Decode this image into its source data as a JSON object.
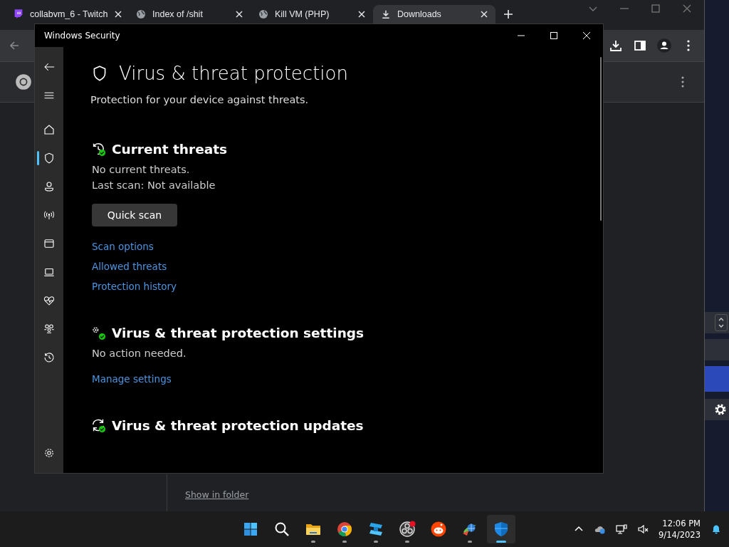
{
  "browser": {
    "tabs": [
      {
        "kind": "twitch",
        "label": "collabvm_6 - Twitch",
        "selected": false
      },
      {
        "kind": "globe",
        "label": "Index of /shit",
        "selected": false
      },
      {
        "kind": "globe",
        "label": "Kill VM (PHP)",
        "selected": false
      },
      {
        "kind": "download",
        "label": "Downloads",
        "selected": true
      }
    ],
    "download_link": "Show in folder"
  },
  "security": {
    "title": "Windows Security",
    "nav": [
      {
        "kind": "home",
        "selected": false
      },
      {
        "kind": "shield",
        "selected": true
      },
      {
        "kind": "person",
        "selected": false
      },
      {
        "kind": "antenna",
        "selected": false
      },
      {
        "kind": "window",
        "selected": false
      },
      {
        "kind": "laptop",
        "selected": false
      },
      {
        "kind": "heart",
        "selected": false
      },
      {
        "kind": "family",
        "selected": false
      },
      {
        "kind": "history",
        "selected": false
      }
    ],
    "page_title": "Virus & threat protection",
    "subtitle": "Protection for your device against threats.",
    "sections": [
      {
        "kind": "threats",
        "title": "Current threats",
        "lines": [
          "No current threats.",
          "Last scan: Not available"
        ],
        "button": "Quick scan",
        "links": [
          "Scan options",
          "Allowed threats",
          "Protection history"
        ]
      },
      {
        "kind": "settings",
        "title": "Virus & threat protection settings",
        "lines": [
          "No action needed."
        ],
        "links": [
          "Manage settings"
        ]
      },
      {
        "kind": "updates",
        "title": "Virus & threat protection updates"
      }
    ]
  },
  "taskbar": {
    "apps": [
      {
        "kind": "start",
        "running": false,
        "active": false
      },
      {
        "kind": "search",
        "running": false,
        "active": false
      },
      {
        "kind": "explorer",
        "running": true,
        "active": false
      },
      {
        "kind": "chrome",
        "running": true,
        "active": false
      },
      {
        "kind": "blocks",
        "running": true,
        "active": false
      },
      {
        "kind": "obs",
        "running": true,
        "active": false
      },
      {
        "kind": "reddit",
        "running": false,
        "active": false
      },
      {
        "kind": "globe",
        "running": true,
        "active": false
      },
      {
        "kind": "security",
        "running": true,
        "active": true
      }
    ],
    "time": "12:06 PM",
    "date": "9/14/2023"
  }
}
